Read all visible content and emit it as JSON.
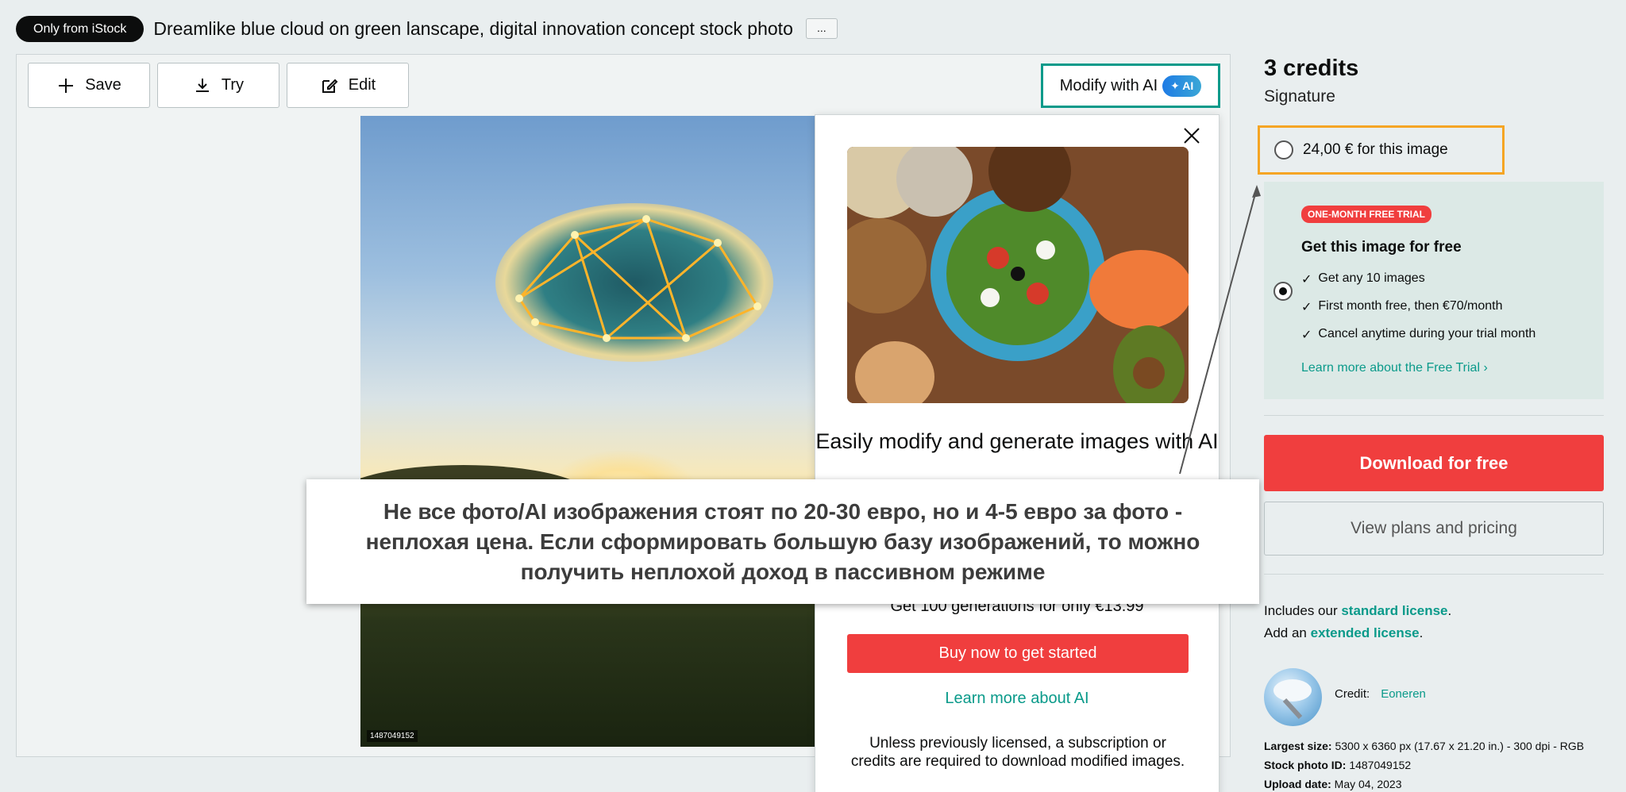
{
  "header": {
    "badge": "Only from iStock",
    "title": "Dreamlike blue cloud on green lanscape, digital innovation concept stock photo",
    "more": "..."
  },
  "toolbar": {
    "save": "Save",
    "try": "Try",
    "edit": "Edit",
    "modify": "Modify with AI",
    "ai_badge": "AI"
  },
  "photo": {
    "id": "1487049152"
  },
  "popup": {
    "title": "Easily modify and generate images with AI",
    "offer": "Get 100 generations for only €13.99",
    "buy": "Buy now to get started",
    "learn": "Learn more about AI",
    "note": "Unless previously licensed, a subscription or credits are required to download modified images."
  },
  "caption": "Не все фото/AI изображения стоят по 20-30 евро, но и 4-5 евро за фото - неплохая цена. Если сформировать большую базу изображений, то можно получить неплохой доход в пассивном режиме",
  "sidebar": {
    "credits": "3 credits",
    "tier": "Signature",
    "price_option": "24,00 € for this image",
    "trial": {
      "badge": "ONE-MONTH FREE TRIAL",
      "heading": "Get this image for free",
      "items": [
        "Get any 10 images",
        "First month free, then €70/month",
        "Cancel anytime during your trial month"
      ],
      "link": "Learn more about the Free Trial ›"
    },
    "download": "Download for free",
    "plans": "View plans and pricing",
    "license1_pre": "Includes our ",
    "license1_link": "standard license",
    "license1_post": ".",
    "license2_pre": "Add an ",
    "license2_link": "extended license",
    "license2_post": ".",
    "credit_label": "Credit:",
    "credit_name": "Eoneren",
    "largest_label": "Largest size:",
    "largest_value": "5300 x 6360 px (17.67 x 21.20 in.) - 300 dpi - RGB",
    "stock_label": "Stock photo ID:",
    "stock_value": "1487049152",
    "upload_label": "Upload date:",
    "upload_value": "May 04, 2023"
  }
}
